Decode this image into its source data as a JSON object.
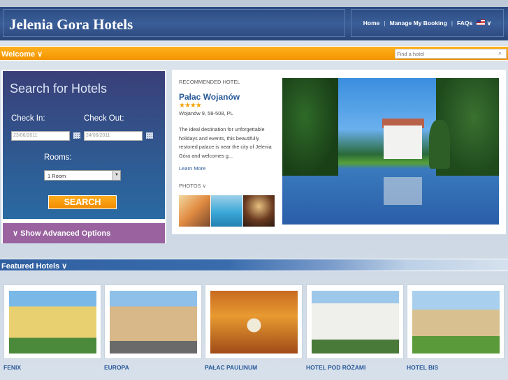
{
  "header": {
    "brand": "Jelenia Gora Hotels",
    "nav": {
      "home": "Home",
      "manage": "Manage My Booking",
      "faqs": "FAQs",
      "sep": "|",
      "chevron": "∨"
    }
  },
  "welcome_bar": {
    "label": "Welcome ∨",
    "find_placeholder": "Find a hotel",
    "search_icon": "⌕"
  },
  "search": {
    "title": "Search for Hotels",
    "check_in_label": "Check In:",
    "check_out_label": "Check Out:",
    "check_in_value": "23/06/2011",
    "check_out_value": "24/06/2011",
    "rooms_label": "Rooms:",
    "rooms_value": "1 Room",
    "select_arrow": "▼",
    "button": "SEARCH",
    "advanced": "∨  Show Advanced Options"
  },
  "recommended": {
    "label": "RECOMMENDED HOTEL",
    "name": "Pałac Wojanów",
    "stars": "★★★★",
    "rating": 4,
    "address": "Wojanów 9, 58-508, PL",
    "description": "The ideal destination for unforgettable holidays and events, this beautifully restored palace is near the city of Jelenia Góra and welcomes g...",
    "learn_more": "Learn More",
    "photos_label": "PHOTOS ∨"
  },
  "featured": {
    "label": "Featured Hotels ∨",
    "hotels": [
      {
        "name": "FENIX"
      },
      {
        "name": "EUROPA"
      },
      {
        "name": "PAŁAC PAULINUM"
      },
      {
        "name": "HOTEL POD RÓŻAMI"
      },
      {
        "name": "HOTEL BIS"
      }
    ]
  },
  "colors": {
    "header_blue": "#2b4a80",
    "accent_orange": "#f39400",
    "link_blue": "#2a5a9a",
    "advanced_purple": "#9a63a0",
    "star_gold": "#f5a000"
  }
}
